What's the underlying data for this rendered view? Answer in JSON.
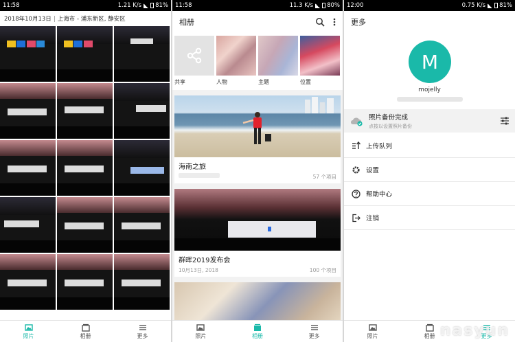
{
  "photos_panel": {
    "status": {
      "time": "11:58",
      "speed": "1.21 K/s",
      "battery": "81%"
    },
    "date_header": {
      "date": "2018年10月13日",
      "location": "上海市 - 浦东新区, 静安区"
    }
  },
  "album_panel": {
    "status": {
      "time": "11:58",
      "speed": "11.3 K/s",
      "battery": "80%"
    },
    "title": "相册",
    "categories": [
      {
        "label": "共享",
        "icon": "share-icon"
      },
      {
        "label": "人物",
        "icon": "people-thumbnail"
      },
      {
        "label": "主题",
        "icon": "theme-thumbnail"
      },
      {
        "label": "位置",
        "icon": "location-thumbnail"
      }
    ],
    "albums": [
      {
        "name": "海南之旅",
        "date": "",
        "count": "57 个项目"
      },
      {
        "name": "群晖2019发布会",
        "date": "10月13日, 2018",
        "count": "100 个项目"
      }
    ]
  },
  "more_panel": {
    "status": {
      "time": "12:00",
      "speed": "0.75 K/s",
      "battery": "81%"
    },
    "title": "更多",
    "avatar_letter": "M",
    "username": "mojelly",
    "backup": {
      "title": "照片备份完成",
      "subtitle": "点按以设置照片备份"
    },
    "menu": [
      {
        "label": "上传队列",
        "icon": "upload-queue-icon"
      },
      {
        "label": "设置",
        "icon": "gear-icon"
      },
      {
        "label": "帮助中心",
        "icon": "help-icon"
      },
      {
        "label": "注销",
        "icon": "logout-icon"
      }
    ],
    "accent_color": "#1ab9a9"
  },
  "bottom_nav": [
    {
      "label": "照片",
      "icon": "photo-icon"
    },
    {
      "label": "相册",
      "icon": "album-icon"
    },
    {
      "label": "更多",
      "icon": "menu-icon"
    }
  ],
  "watermark": "nasyun"
}
